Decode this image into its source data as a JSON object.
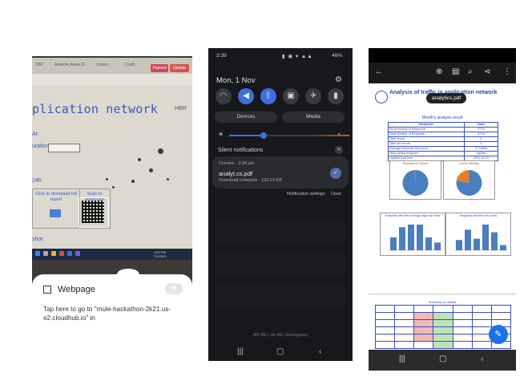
{
  "panel1": {
    "browser_tabs": [
      "DBC",
      "Amazon Alexa D...",
      "Conve...",
      "Confi..."
    ],
    "ext_buttons": [
      "Paused",
      "Update"
    ],
    "page_title": "plication network",
    "hbr": "HBR",
    "label_ai": "AI:",
    "label_duration": "uration:",
    "label_24h": "24h",
    "cell_download": "Click to download full report",
    "cell_scan": "Scan to download",
    "label_snapshot": "shot",
    "taskbar_time": "3:00 PM",
    "taskbar_date": "7/1/2021",
    "notification": {
      "icon": "qr-code-icon",
      "title": "Webpage",
      "body": "Tap here to go to \"mule-hackathon-2k21.us-e2.cloudhub.io\" in"
    }
  },
  "panel2": {
    "time": "2:39",
    "status_right": "46%",
    "date": "Mon, 1 Nov",
    "quick_settings": [
      {
        "icon": "wifi-icon",
        "glyph": "◠",
        "on": false
      },
      {
        "icon": "mute-icon",
        "glyph": "◀",
        "on": true
      },
      {
        "icon": "bluetooth-icon",
        "glyph": "ᛒ",
        "on": true
      },
      {
        "icon": "rotation-icon",
        "glyph": "▣",
        "on": false
      },
      {
        "icon": "airplane-icon",
        "glyph": "✈",
        "on": false
      },
      {
        "icon": "flashlight-icon",
        "glyph": "▮",
        "on": false
      }
    ],
    "devices_label": "Devices",
    "media_label": "Media",
    "brightness": 0.35,
    "silent_label": "Silent notifications",
    "card": {
      "app": "Chrome · 2:39 am",
      "file": "analyt.cs.pdf",
      "status": "Download complete · 193.23 KB"
    },
    "notification_settings": "Notification settings",
    "clear_label": "Clear",
    "carrier": "JIO 4G | Jio 4G | Emergency"
  },
  "panel3": {
    "file_pill": "analytics.pdf",
    "doc_title": "Analysis of traffic in application network",
    "section_title": "Month's analysis result",
    "table_header": [
      "Parameter",
      "Value"
    ],
    "table_rows": [
      [
        "No of records in Response",
        "3776"
      ],
      [
        "Total Number of Requests",
        "3776"
      ],
      [
        "Total errors",
        "0"
      ],
      [
        "Total 4xx errors",
        "0"
      ],
      [
        "Average response time (ms)",
        "77.94656"
      ],
      [
        "Most visited endpoint",
        "/api/list"
      ],
      [
        "Highest load time",
        "2021-10-01"
      ]
    ],
    "pie_titles": [
      "Success vs Failure",
      "Cache Hit/Miss"
    ],
    "pie_data": [
      {
        "segments": [
          {
            "value": 99,
            "color": "#4a7fbf"
          },
          {
            "value": 1,
            "color": "#e67e22"
          }
        ]
      },
      {
        "segments": [
          {
            "value": 78,
            "color": "#4a7fbf"
          },
          {
            "value": 22,
            "color": "#e67e22"
          }
        ]
      }
    ],
    "bar_titles": [
      "Endpoints with their average response times",
      "Endpoints with their hit counts"
    ],
    "bar_data": [
      {
        "values": [
          0.5,
          0.9,
          1.0,
          1.0,
          0.5,
          0.3
        ]
      },
      {
        "values": [
          0.4,
          0.8,
          0.45,
          1.0,
          0.7,
          0.2
        ]
      }
    ],
    "page2_title": "Summary of results",
    "fab_icon": "edit-icon"
  }
}
